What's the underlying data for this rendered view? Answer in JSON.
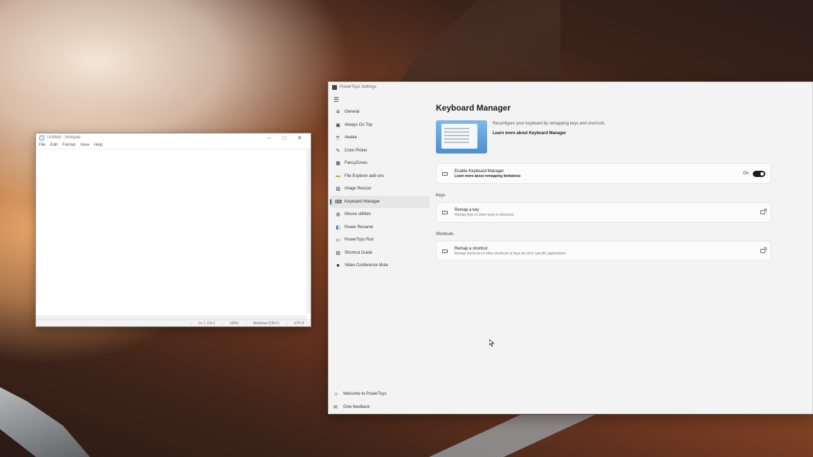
{
  "notepad": {
    "title": "Untitled - Notepad",
    "menu": [
      "File",
      "Edit",
      "Format",
      "View",
      "Help"
    ],
    "status": [
      "Ln 1, Col 1",
      "100%",
      "Windows (CRLF)",
      "UTF-8"
    ]
  },
  "powertoys": {
    "window_title": "PowerToys Settings",
    "nav_items": [
      {
        "label": "General",
        "icon": "gear-icon"
      },
      {
        "label": "Always On Top",
        "icon": "pin-icon"
      },
      {
        "label": "Awake",
        "icon": "coffee-icon"
      },
      {
        "label": "Color Picker",
        "icon": "color-picker-icon"
      },
      {
        "label": "FancyZones",
        "icon": "zones-icon"
      },
      {
        "label": "File Explorer add-ons",
        "icon": "folder-icon"
      },
      {
        "label": "Image Resizer",
        "icon": "image-icon"
      },
      {
        "label": "Keyboard Manager",
        "icon": "keyboard-icon",
        "active": true
      },
      {
        "label": "Mouse utilities",
        "icon": "mouse-icon"
      },
      {
        "label": "Power Rename",
        "icon": "rename-icon"
      },
      {
        "label": "PowerToys Run",
        "icon": "run-icon"
      },
      {
        "label": "Shortcut Guide",
        "icon": "shortcut-guide-icon"
      },
      {
        "label": "Video Conference Mute",
        "icon": "camera-icon"
      }
    ],
    "nav_bottom": [
      {
        "label": "Welcome to PowerToys",
        "icon": "welcome-icon"
      },
      {
        "label": "Give feedback",
        "icon": "feedback-icon"
      }
    ],
    "page": {
      "title": "Keyboard Manager",
      "description": "Reconfigure your keyboard by remapping keys and shortcuts",
      "learn_more": "Learn more about Keyboard Manager",
      "enable": {
        "title": "Enable Keyboard Manager",
        "subtitle": "Learn more about remapping limitations",
        "toggle_label": "On",
        "toggle_on": true
      },
      "keys_section": "Keys",
      "remap_key": {
        "title": "Remap a key",
        "subtitle": "Remap keys to other keys or shortcuts"
      },
      "shortcuts_section": "Shortcuts",
      "remap_shortcut": {
        "title": "Remap a shortcut",
        "subtitle": "Remap shortcuts to other shortcuts or keys for all or specific applications"
      }
    }
  }
}
